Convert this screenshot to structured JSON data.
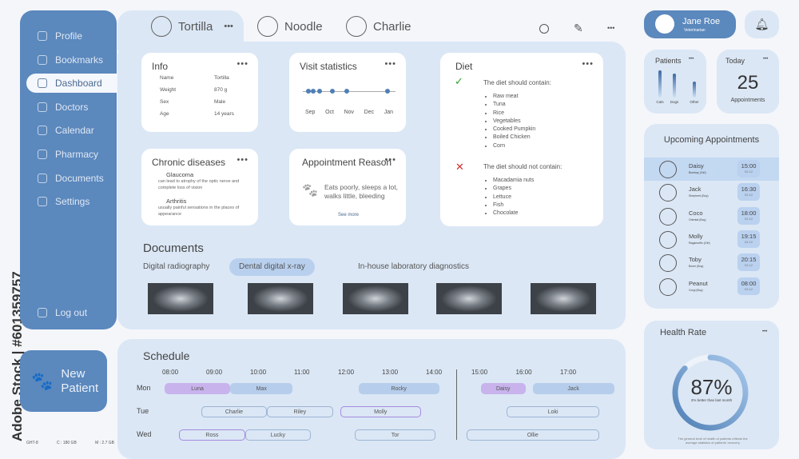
{
  "watermark": "Adobe Stock | #601359757",
  "sidebar": {
    "items": [
      {
        "label": "Profile",
        "icon": "user-icon"
      },
      {
        "label": "Bookmarks",
        "icon": "bookmark-icon"
      },
      {
        "label": "Dashboard",
        "icon": "dashboard-icon",
        "active": true
      },
      {
        "label": "Doctors",
        "icon": "doctor-icon"
      },
      {
        "label": "Calendar",
        "icon": "calendar-icon"
      },
      {
        "label": "Pharmacy",
        "icon": "pharmacy-icon"
      },
      {
        "label": "Documents",
        "icon": "document-icon"
      },
      {
        "label": "Settings",
        "icon": "gear-icon"
      }
    ],
    "logout": "Log out"
  },
  "new_patient": {
    "line1": "New",
    "line2": "Patient"
  },
  "footer": {
    "a": "GHT-8",
    "b": "C : 180 GB",
    "c": "M : 2.7 GB"
  },
  "tabs": [
    {
      "label": "Tortilla",
      "active": true
    },
    {
      "label": "Noodle"
    },
    {
      "label": "Charlie"
    }
  ],
  "info": {
    "title": "Info",
    "rows": [
      [
        "Name",
        "Tortilla"
      ],
      [
        "Weight",
        "870 g"
      ],
      [
        "Sex",
        "Male"
      ],
      [
        "Age",
        "14 years"
      ]
    ]
  },
  "visits": {
    "title": "Visit statistics",
    "months": [
      "Sep",
      "Oct",
      "Nov",
      "Dec",
      "Jan"
    ]
  },
  "diet": {
    "title": "Diet",
    "should": "The diet should contain:",
    "should_items": [
      "Raw meat",
      "Tuna",
      "Rice",
      "Vegetables",
      "Cooked Pumpkin",
      "Boiled Chicken",
      "Corn"
    ],
    "should_not": "The diet should not contain:",
    "not_items": [
      "Macadamia nuts",
      "Grapes",
      "Lettuce",
      "Fish",
      "Chocolate"
    ],
    "ok_color": "#2aa52a",
    "bad_color": "#d03030"
  },
  "chronic": {
    "title": "Chronic diseases",
    "items": [
      {
        "name": "Glaucoma",
        "desc": "can lead to atrophy of the optic nerve and complete loss of vision"
      },
      {
        "name": "Arthritis",
        "desc": "usually painful sensations in the places of appearance"
      }
    ]
  },
  "reason": {
    "title": "Appointment Reason",
    "text": "Eats poorly, sleeps a lot, walks little, bleeding",
    "more": "See more"
  },
  "documents": {
    "title": "Documents",
    "tabs": [
      "Digital radiography",
      "Dental digital x-ray",
      "In-house laboratory diagnostics"
    ],
    "active": 1
  },
  "user": {
    "name": "Jane Roe",
    "role": "Veterinarian"
  },
  "patients": {
    "title": "Patients",
    "labels": [
      "Cats",
      "Dogs",
      "Other"
    ]
  },
  "today": {
    "title": "Today",
    "count": "25",
    "label": "Appointments"
  },
  "upcoming": {
    "title": "Upcoming Appointments",
    "items": [
      {
        "name": "Daisy",
        "breed": "Bombay (Girl)",
        "time": "15:00",
        "date": "02.12"
      },
      {
        "name": "Jack",
        "breed": "Shepherd (Boy)",
        "time": "16:30",
        "date": "02.12"
      },
      {
        "name": "Coco",
        "breed": "Oriental (Boy)",
        "time": "18:00",
        "date": "02.12"
      },
      {
        "name": "Molly",
        "breed": "Ragamuffin (Girl)",
        "time": "19:15",
        "date": "02.12"
      },
      {
        "name": "Toby",
        "breed": "Boxer (Boy)",
        "time": "20:15",
        "date": "02.12"
      },
      {
        "name": "Peanut",
        "breed": "Corgi (Boy)",
        "time": "08:00",
        "date": "03.12"
      }
    ]
  },
  "health": {
    "title": "Health Rate",
    "value": "87%",
    "percent": 87,
    "sub": "2% better than last month",
    "note": "The general level of health of patients reflects the average statistics of patients' recovery"
  },
  "schedule": {
    "title": "Schedule",
    "times": [
      "08:00",
      "09:00",
      "10:00",
      "11:00",
      "12:00",
      "13:00",
      "14:00",
      "15:00",
      "16:00",
      "17:00"
    ],
    "days": [
      "Mon",
      "Tue",
      "Wed"
    ],
    "events": [
      {
        "day": 0,
        "name": "Luna",
        "start": "07:50",
        "end": "09:20",
        "style": "filled-purple"
      },
      {
        "day": 0,
        "name": "Max",
        "start": "09:20",
        "end": "10:45",
        "style": "filled-blue"
      },
      {
        "day": 0,
        "name": "Rocky",
        "start": "12:15",
        "end": "14:05",
        "style": "filled-blue"
      },
      {
        "day": 0,
        "name": "Daisy",
        "start": "15:00",
        "end": "16:00",
        "style": "filled-purple"
      },
      {
        "day": 0,
        "name": "Jack",
        "start": "16:10",
        "end": "18:00",
        "style": "filled-blue"
      },
      {
        "day": 1,
        "name": "Charlie",
        "start": "08:40",
        "end": "10:10",
        "style": "outline"
      },
      {
        "day": 1,
        "name": "Riley",
        "start": "10:10",
        "end": "11:40",
        "style": "outline"
      },
      {
        "day": 1,
        "name": "Molly",
        "start": "11:50",
        "end": "13:40",
        "style": "outline-purple"
      },
      {
        "day": 1,
        "name": "Loki",
        "start": "15:35",
        "end": "17:40",
        "style": "outline"
      },
      {
        "day": 2,
        "name": "Ross",
        "start": "08:10",
        "end": "09:40",
        "style": "outline-purple"
      },
      {
        "day": 2,
        "name": "Lucky",
        "start": "09:40",
        "end": "11:10",
        "style": "outline"
      },
      {
        "day": 2,
        "name": "Tor",
        "start": "12:10",
        "end": "14:00",
        "style": "outline"
      },
      {
        "day": 2,
        "name": "Ollie",
        "start": "14:40",
        "end": "17:40",
        "style": "outline"
      }
    ]
  }
}
